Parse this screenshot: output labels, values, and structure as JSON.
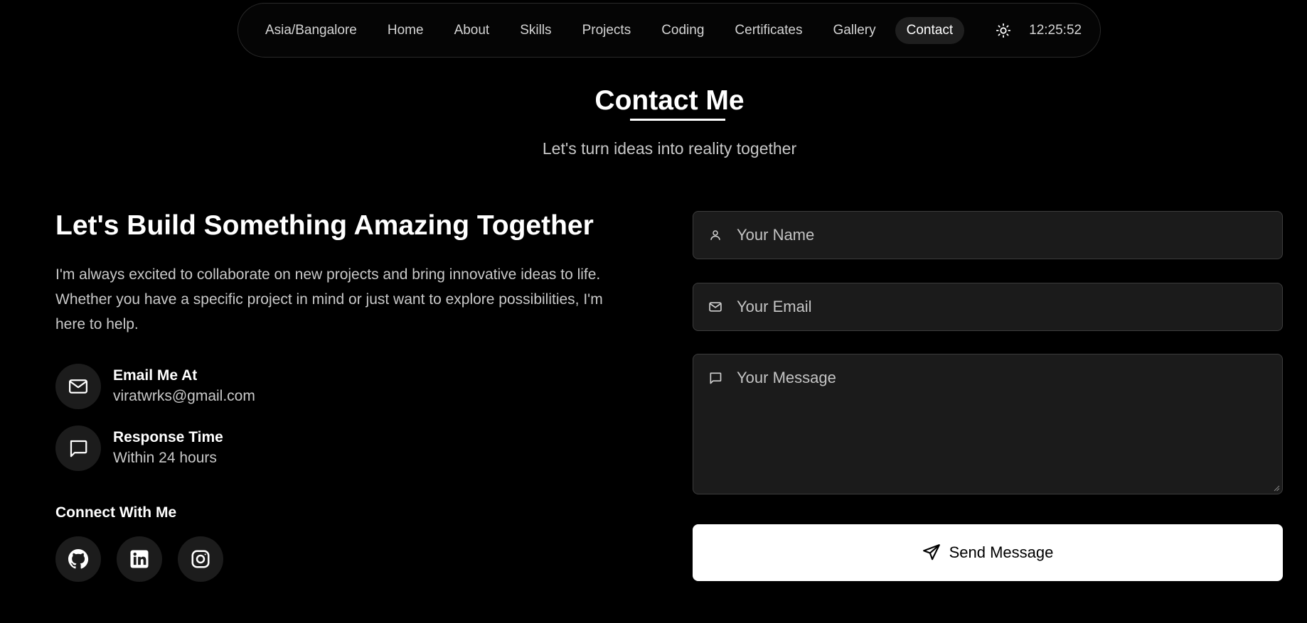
{
  "nav": {
    "timezone": "Asia/Bangalore",
    "items": [
      {
        "label": "Home"
      },
      {
        "label": "About"
      },
      {
        "label": "Skills"
      },
      {
        "label": "Projects"
      },
      {
        "label": "Coding"
      },
      {
        "label": "Certificates"
      },
      {
        "label": "Gallery"
      },
      {
        "label": "Contact",
        "active": true
      }
    ],
    "theme_icon": "sun-icon",
    "clock": "12:25:52"
  },
  "header": {
    "title": "Contact Me",
    "subtitle": "Let's turn ideas into reality together"
  },
  "intro": {
    "heading": "Let's Build Something Amazing Together",
    "text": "I'm always excited to collaborate on new projects and bring innovative ideas to life. Whether you have a specific project in mind or just want to explore possibilities, I'm here to help."
  },
  "info": {
    "email": {
      "title": "Email Me At",
      "value": "viratwrks@gmail.com",
      "icon": "mail-icon"
    },
    "response": {
      "title": "Response Time",
      "value": "Within 24 hours",
      "icon": "chat-icon"
    }
  },
  "connect": {
    "title": "Connect With Me",
    "socials": [
      {
        "icon": "github-icon"
      },
      {
        "icon": "linkedin-icon"
      },
      {
        "icon": "instagram-icon"
      }
    ]
  },
  "form": {
    "name_placeholder": "Your Name",
    "email_placeholder": "Your Email",
    "message_placeholder": "Your Message",
    "send_label": "Send Message"
  },
  "colors": {
    "background": "#000000",
    "field_bg": "#1b1b1b",
    "accent": "#ffffff",
    "muted_text": "#c9c9c9"
  }
}
